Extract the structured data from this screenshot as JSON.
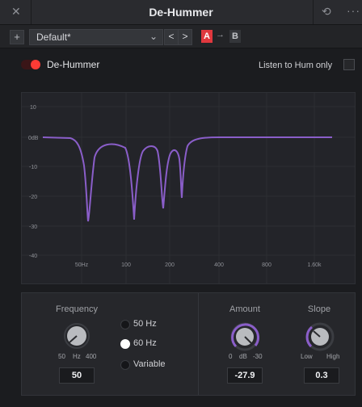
{
  "window": {
    "title": "De-Hummer",
    "close_glyph": "✕",
    "reset_glyph": "⟲",
    "more_glyph": "···"
  },
  "preset_bar": {
    "add_glyph": "+",
    "preset_name": "Default*",
    "chevron_glyph": "⌄",
    "prev_glyph": "<",
    "next_glyph": ">",
    "a_label": "A",
    "copy_glyph": "→",
    "b_label": "B"
  },
  "plugin": {
    "enable_label": "De-Hummer",
    "enabled": true,
    "listen_label": "Listen to Hum only",
    "listen_checked": false
  },
  "graph": {
    "y_ticks": [
      "10",
      "0dB",
      "-10",
      "-20",
      "-30",
      "-40"
    ],
    "x_ticks": [
      "50Hz",
      "100",
      "200",
      "400",
      "800",
      "1.60k"
    ],
    "curve_color": "#8a5ec9"
  },
  "controls": {
    "frequency": {
      "label": "Frequency",
      "scale_min": "50",
      "scale_unit": "Hz",
      "scale_max": "400",
      "value": "50"
    },
    "hum_modes": [
      {
        "label": "50 Hz",
        "selected": false
      },
      {
        "label": "60 Hz",
        "selected": true
      },
      {
        "label": "Variable",
        "selected": false
      }
    ],
    "amount": {
      "label": "Amount",
      "scale_min": "0",
      "scale_unit": "dB",
      "scale_max": "-30",
      "value": "-27.9",
      "level_fraction": 0.93
    },
    "slope": {
      "label": "Slope",
      "scale_min": "Low",
      "scale_max": "High",
      "value": "0.3",
      "level_fraction": 0.3
    },
    "accent_color": "#8a5ec9"
  }
}
